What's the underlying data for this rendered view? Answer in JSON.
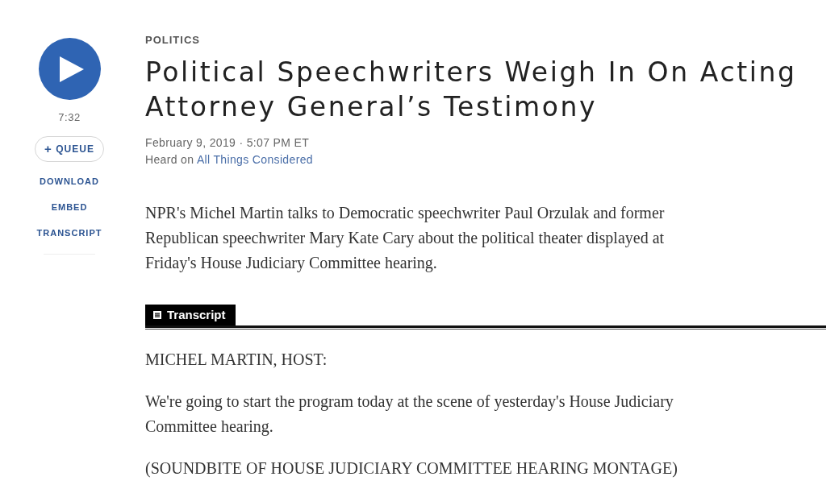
{
  "player": {
    "duration": "7:32",
    "queue": {
      "icon": "+",
      "label": "QUEUE"
    },
    "actions": [
      "DOWNLOAD",
      "EMBED",
      "TRANSCRIPT"
    ]
  },
  "article": {
    "section": "POLITICS",
    "title": "Political Speechwriters Weigh In On Acting Attorney General’s Testimony",
    "dateline": "February 9, 2019 · 5:07 PM ET",
    "heard_on": {
      "text": "Heard on",
      "program": "All Things Considered"
    },
    "summary": "NPR's Michel Martin talks to Democratic speechwriter Paul Orzulak and former Republican speechwriter Mary Kate Cary about the political theater displayed at Friday's House Judiciary Committee hearing."
  },
  "transcript": {
    "heading": "Transcript",
    "paragraphs": [
      "MICHEL MARTIN, HOST:",
      "We're going to start the program today at the scene of yesterday's House Judiciary Committee hearing.",
      "(SOUNDBITE OF HOUSE JUDICIARY COMMITTEE HEARING MONTAGE)"
    ]
  }
}
